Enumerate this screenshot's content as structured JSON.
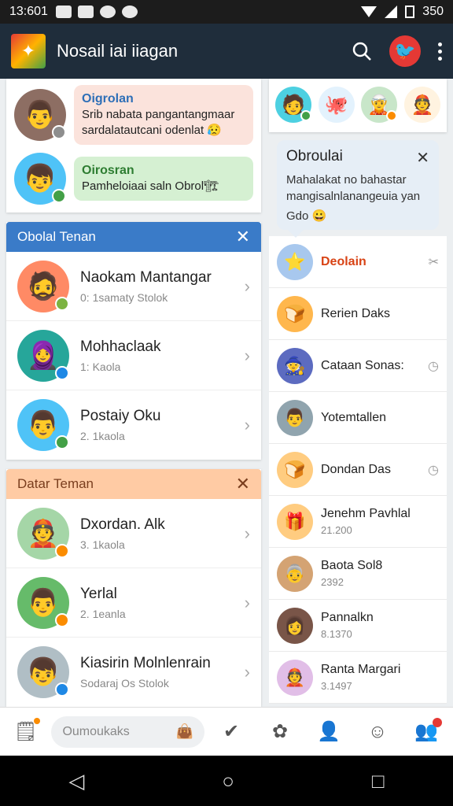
{
  "status_bar": {
    "time": "13:601",
    "battery": "350"
  },
  "app_bar": {
    "title": "Nosail iai iiagan"
  },
  "messages": [
    {
      "sender": "Oigrolan",
      "text": "Srib nabata pangantangmaar sardalatautcani odenlat 😥",
      "color": "pink",
      "dot": "#8e8e8e",
      "emoji": "👨"
    },
    {
      "sender": "Oirosran",
      "text": "Pamheloiaai saln Obrol🏗",
      "color": "green",
      "dot": "#43a047",
      "emoji": "👦"
    }
  ],
  "section_online": {
    "title": "Obolal Tenan",
    "friends": [
      {
        "name": "Naokam Mantangar",
        "status": "0: 1samaty Stolok",
        "dot": "#7cb342",
        "emoji": "🧔"
      },
      {
        "name": "Mohhaclaak",
        "status": "1: Kaola",
        "dot": "#1e88e5",
        "emoji": "🧕"
      },
      {
        "name": "Postaiy Oku",
        "status": "2. 1kaola",
        "dot": "#43a047",
        "emoji": "👨"
      }
    ]
  },
  "section_list": {
    "title": "Datar Teman",
    "friends": [
      {
        "name": "Dxordan. Alk",
        "status": "3. 1kaola",
        "dot": "#fb8c00",
        "emoji": "👲"
      },
      {
        "name": "Yerlal",
        "status": "2. 1eanla",
        "dot": "#fb8c00",
        "emoji": "👨"
      },
      {
        "name": "Kiasirin Molnlenrain",
        "status": "Sodaraj Os Stolok",
        "dot": "#1e88e5",
        "emoji": "👦"
      }
    ]
  },
  "right_top_avatars": [
    "🧑",
    "🐙",
    "🧝",
    "👲"
  ],
  "popup": {
    "title": "Obroulai",
    "body": "Mahalakat no bahastar mangisalnlanangeuia yan",
    "footer": "Gdo 😀"
  },
  "right_list": [
    {
      "title": "Deolain",
      "sub": "",
      "icon": "⭐",
      "bg": "#a8c8ee",
      "title_color": "#d84315",
      "right": "✂"
    },
    {
      "title": "Rerien Daks",
      "sub": "",
      "icon": "🍞",
      "bg": "#ffb74d",
      "title_color": "#222",
      "right": ""
    },
    {
      "title": "Cataan Sonas:",
      "sub": "",
      "icon": "🧙",
      "bg": "#5c6bc0",
      "title_color": "#222",
      "right": "◷"
    },
    {
      "title": "Yotemtallen",
      "sub": "",
      "icon": "👨",
      "bg": "#90a4ae",
      "title_color": "#222",
      "right": ""
    },
    {
      "title": "Dondan Das",
      "sub": "",
      "icon": "🍞",
      "bg": "#ffcc80",
      "title_color": "#222",
      "right": "◷"
    },
    {
      "title": "Jenehm Pavhlal",
      "sub": "21.200",
      "icon": "🎁",
      "bg": "#ffcc80",
      "title_color": "#222",
      "right": ""
    },
    {
      "title": "Baota Sol8",
      "sub": "2392",
      "icon": "👵",
      "bg": "#d4a373",
      "title_color": "#222",
      "right": ""
    },
    {
      "title": "Pannalkn",
      "sub": "8.1370",
      "icon": "👩",
      "bg": "#795548",
      "title_color": "#222",
      "right": ""
    },
    {
      "title": "Ranta Margari",
      "sub": "3.1497",
      "icon": "👲",
      "bg": "#e1bee7",
      "title_color": "#222",
      "right": ""
    }
  ],
  "bottom_bar": {
    "search_placeholder": "Oumoukaks"
  },
  "icons": {
    "search": "search-icon",
    "more": "more-vert-icon",
    "close": "close-icon",
    "chevron": "chevron-right-icon"
  }
}
